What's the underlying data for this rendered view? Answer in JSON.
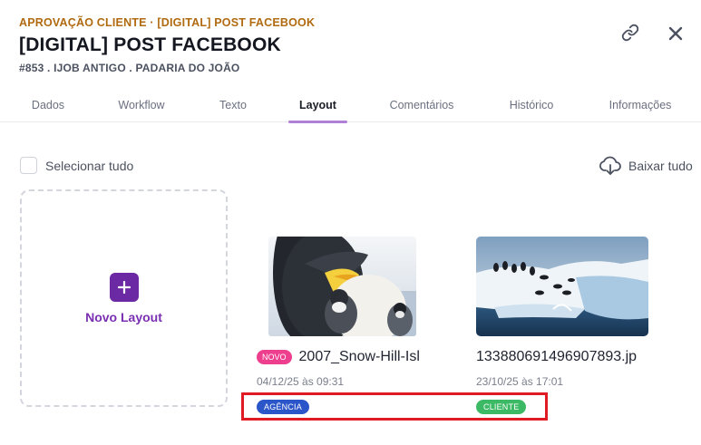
{
  "header": {
    "breadcrumb": "APROVAÇÃO CLIENTE · [DIGITAL] POST FACEBOOK",
    "title": "[DIGITAL] POST FACEBOOK",
    "subtitle": "#853 . IJOB ANTIGO . PADARIA DO JOÃO",
    "link_icon": "link-icon",
    "close_icon": "close-icon"
  },
  "tabs": [
    {
      "label": "Dados",
      "active": false
    },
    {
      "label": "Workflow",
      "active": false
    },
    {
      "label": "Texto",
      "active": false
    },
    {
      "label": "Layout",
      "active": true
    },
    {
      "label": "Comentários",
      "active": false
    },
    {
      "label": "Histórico",
      "active": false
    },
    {
      "label": "Informações",
      "active": false
    }
  ],
  "toolbar": {
    "select_all_label": "Selecionar tudo",
    "download_all_label": "Baixar tudo"
  },
  "new_layout": {
    "label": "Novo Layout"
  },
  "files": [
    {
      "badge": "NOVO",
      "name": "2007_Snow-Hill-Isl",
      "date": "04/12/25 às 09:31",
      "tag": "AGÊNCIA",
      "tag_color": "#2b56c9",
      "thumbnail": "penguins-image"
    },
    {
      "badge": "",
      "name": "133880691496907893.jp",
      "date": "23/10/25 às 17:01",
      "tag": "CLIENTE",
      "tag_color": "#3cb965",
      "thumbnail": "iceberg-penguins-image"
    }
  ],
  "colors": {
    "accent": "#6b2aa3",
    "breadcrumb": "#b06a10",
    "new_badge": "#ee3f8e",
    "highlight": "#e01b24"
  }
}
